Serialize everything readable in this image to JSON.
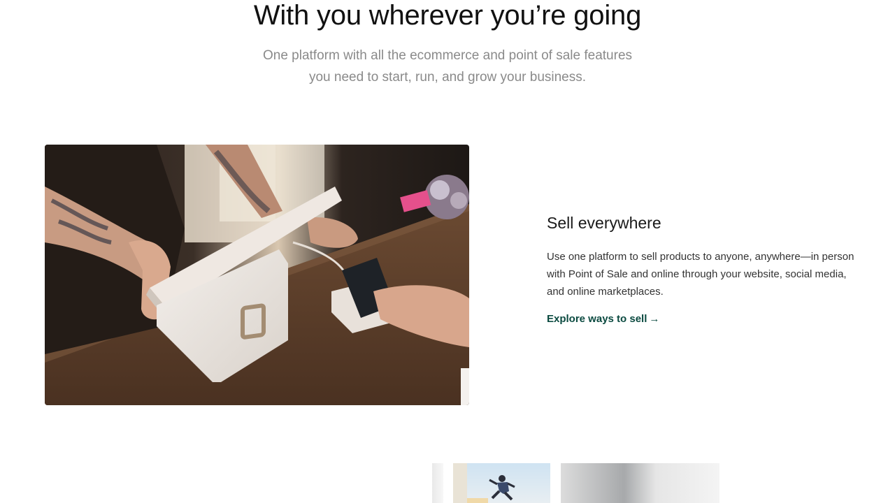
{
  "hero": {
    "title": "With you wherever you’re going",
    "subtitle_line1": "One platform with all the ecommerce and point of sale features",
    "subtitle_line2": "you need to start, run, and grow your business."
  },
  "feature": {
    "heading": "Sell everywhere",
    "body": "Use one platform to sell products to anyone, anywhere—in person with Point of Sale and online through your website, social media, and online marketplaces.",
    "link_label": "Explore ways to sell",
    "link_arrow": "→"
  },
  "colors": {
    "link": "#0b4a40",
    "subtitle": "#8a8a8a"
  }
}
